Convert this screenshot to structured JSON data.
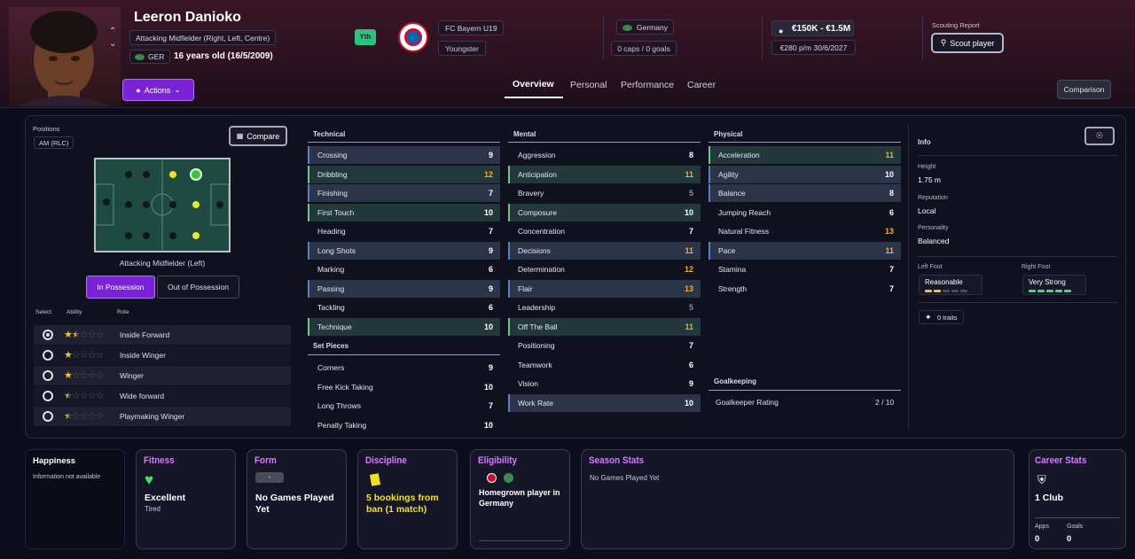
{
  "header": {
    "player_name": "Leeron Danioko",
    "position": "Attacking Midfielder (Right, Left, Centre)",
    "nation_code": "GER",
    "age_text": "16 years old (16/5/2009)",
    "yth_badge": "Yth",
    "club": "FC Bayern U19",
    "squad_status": "Youngster",
    "nation": "Germany",
    "caps_goals": "0 caps / 0 goals",
    "value_range": "€150K - €1.5M",
    "wage_contract": "€280 p/m 30/6/2027",
    "scouting_label": "Scouting Report",
    "scout_button": "Scout player",
    "actions_button": "Actions",
    "comparison_button": "Comparison",
    "tabs": [
      "Overview",
      "Personal",
      "Performance",
      "Career"
    ]
  },
  "positions": {
    "label": "Positions",
    "badge": "AM (RLC)",
    "compare_button": "Compare",
    "selected_position": "Attacking Midfielder (Left)",
    "toggle_in": "In Possession",
    "toggle_out": "Out of Possession",
    "col_select": "Select",
    "col_ability": "Ability",
    "col_role": "Role",
    "roles": [
      {
        "name": "Inside Forward",
        "stars": 1.5,
        "selected": true
      },
      {
        "name": "Inside Winger",
        "stars": 1,
        "selected": false
      },
      {
        "name": "Winger",
        "stars": 1,
        "selected": false
      },
      {
        "name": "Wide forward",
        "stars": 0.5,
        "selected": false
      },
      {
        "name": "Playmaking Winger",
        "stars": 0.5,
        "selected": false
      }
    ]
  },
  "technical": {
    "title": "Technical",
    "items": [
      {
        "name": "Crossing",
        "value": "9"
      },
      {
        "name": "Dribbling",
        "value": "12"
      },
      {
        "name": "Finishing",
        "value": "7"
      },
      {
        "name": "First Touch",
        "value": "10"
      },
      {
        "name": "Heading",
        "value": "7"
      },
      {
        "name": "Long Shots",
        "value": "9"
      },
      {
        "name": "Marking",
        "value": "6"
      },
      {
        "name": "Passing",
        "value": "9"
      },
      {
        "name": "Tackling",
        "value": "6"
      },
      {
        "name": "Technique",
        "value": "10"
      }
    ]
  },
  "set_pieces": {
    "title": "Set Pieces",
    "items": [
      {
        "name": "Corners",
        "value": "9"
      },
      {
        "name": "Free Kick Taking",
        "value": "10"
      },
      {
        "name": "Long Throws",
        "value": "7"
      },
      {
        "name": "Penalty Taking",
        "value": "10"
      }
    ]
  },
  "mental": {
    "title": "Mental",
    "items": [
      {
        "name": "Aggression",
        "value": "8"
      },
      {
        "name": "Anticipation",
        "value": "11"
      },
      {
        "name": "Bravery",
        "value": "5"
      },
      {
        "name": "Composure",
        "value": "10"
      },
      {
        "name": "Concentration",
        "value": "7"
      },
      {
        "name": "Decisions",
        "value": "11"
      },
      {
        "name": "Determination",
        "value": "12"
      },
      {
        "name": "Flair",
        "value": "13"
      },
      {
        "name": "Leadership",
        "value": "5"
      },
      {
        "name": "Off The Ball",
        "value": "11"
      },
      {
        "name": "Positioning",
        "value": "7"
      },
      {
        "name": "Teamwork",
        "value": "6"
      },
      {
        "name": "Vision",
        "value": "9"
      },
      {
        "name": "Work Rate",
        "value": "10"
      }
    ]
  },
  "physical": {
    "title": "Physical",
    "items": [
      {
        "name": "Acceleration",
        "value": "11"
      },
      {
        "name": "Agility",
        "value": "10"
      },
      {
        "name": "Balance",
        "value": "8"
      },
      {
        "name": "Jumping Reach",
        "value": "6"
      },
      {
        "name": "Natural Fitness",
        "value": "13"
      },
      {
        "name": "Pace",
        "value": "11"
      },
      {
        "name": "Stamina",
        "value": "7"
      },
      {
        "name": "Strength",
        "value": "7"
      }
    ]
  },
  "goalkeeping": {
    "title": "Goalkeeping",
    "rating_label": "Goalkeeper Rating",
    "rating_value": "2 / 10"
  },
  "info": {
    "title": "Info",
    "height_label": "Height",
    "height": "1.75 m",
    "reputation_label": "Reputation",
    "reputation": "Local",
    "personality_label": "Personality",
    "personality": "Balanced",
    "left_foot_label": "Left Foot",
    "left_foot": "Reasonable",
    "left_foot_level": 2,
    "right_foot_label": "Right Foot",
    "right_foot": "Very Strong",
    "right_foot_level": 5,
    "traits": "0 traits"
  },
  "cards": {
    "happiness_title": "Happiness",
    "happiness_text": "Information not available",
    "fitness_title": "Fitness",
    "fitness_value": "Excellent",
    "fitness_sub": "Tired",
    "form_title": "Form",
    "form_badge": "-",
    "form_value": "No Games Played Yet",
    "discipline_title": "Discipline",
    "discipline_value": "5 bookings from ban (1 match)",
    "eligibility_title": "Eligibility",
    "eligibility_value": "Homegrown player in Germany",
    "season_title": "Season Stats",
    "season_text": "No Games Played Yet",
    "career_title": "Career Stats",
    "career_clubs": "1 Club",
    "apps_label": "Apps",
    "apps_value": "0",
    "goals_label": "Goals",
    "goals_value": "0"
  },
  "colors": {
    "accent_purple": "#8a2be2",
    "highlight_yellow": "#f2b02a",
    "card_title": "#d87aff",
    "yth_green": "#2ec27e"
  }
}
